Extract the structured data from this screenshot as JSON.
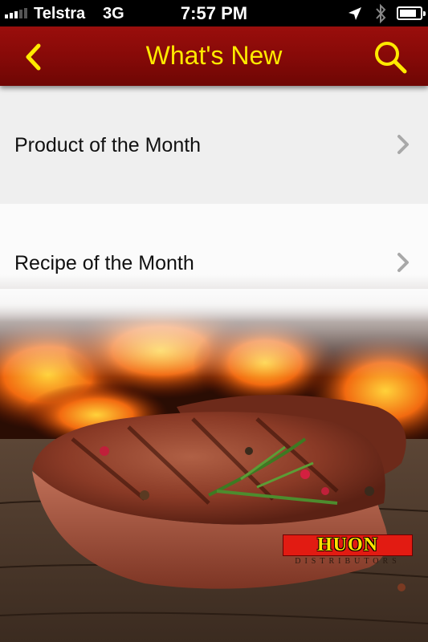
{
  "status_bar": {
    "carrier": "Telstra",
    "network": "3G",
    "time": "7:57 PM",
    "signal_bars_active": 3,
    "signal_bars_total": 5,
    "icons": [
      "location-arrow-icon",
      "bluetooth-icon",
      "battery-icon"
    ]
  },
  "nav_bar": {
    "title": "What's New",
    "back_icon": "chevron-left-icon",
    "search_icon": "search-icon",
    "color": "#8e0b09",
    "title_color": "#ffea00"
  },
  "menu": {
    "items": [
      {
        "label": "Product of the Month",
        "icon": "chevron-right-icon"
      },
      {
        "label": "Recipe of the Month",
        "icon": "chevron-right-icon"
      }
    ]
  },
  "background": {
    "subject": "grilled-steak-photo"
  },
  "logo": {
    "name": "HUON",
    "tagline": "DISTRIBUTORS"
  }
}
